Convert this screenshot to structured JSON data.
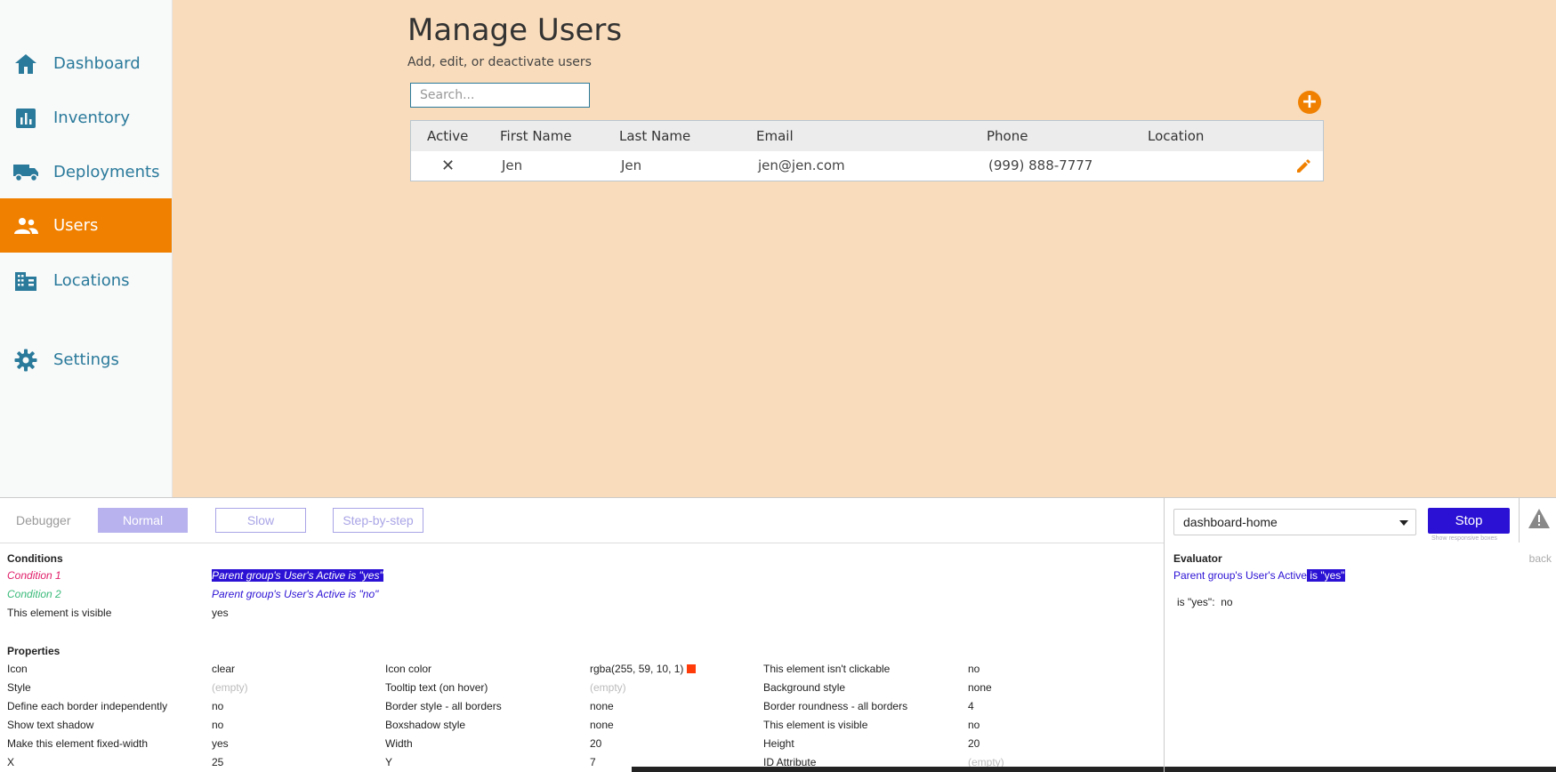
{
  "sidebar": {
    "items": [
      {
        "label": "Dashboard",
        "icon": "home-icon"
      },
      {
        "label": "Inventory",
        "icon": "bar-chart-icon"
      },
      {
        "label": "Deployments",
        "icon": "truck-icon"
      },
      {
        "label": "Users",
        "icon": "users-icon",
        "active": true
      },
      {
        "label": "Locations",
        "icon": "building-icon"
      },
      {
        "label": "Settings",
        "icon": "gear-icon"
      }
    ]
  },
  "main": {
    "title": "Manage Users",
    "subtitle": "Add, edit, or deactivate users",
    "search_placeholder": "Search...",
    "add_symbol": "+",
    "table": {
      "headers": [
        "Active",
        "First Name",
        "Last Name",
        "Email",
        "Phone",
        "Location"
      ],
      "rows": [
        {
          "active": "✕",
          "first_name": "Jen",
          "last_name": "Jen",
          "email": "jen@jen.com",
          "phone": "(999) 888-7777",
          "location": ""
        }
      ]
    }
  },
  "debugger": {
    "label": "Debugger",
    "modes": [
      "Normal",
      "Slow",
      "Step-by-step"
    ],
    "active_mode": "Normal",
    "page_select": "dashboard-home",
    "stop_label": "Stop",
    "responsive_label": "Show responsive boxes",
    "conditions": {
      "title": "Conditions",
      "items": [
        {
          "name": "Condition 1",
          "expr": "Parent group's User's Active is \"yes\""
        },
        {
          "name": "Condition 2",
          "expr": "Parent group's User's Active is \"no\""
        },
        {
          "name": "This element is visible",
          "expr": "yes"
        }
      ]
    },
    "properties": {
      "title": "Properties",
      "rows": [
        [
          [
            "Icon",
            "clear"
          ],
          [
            "Icon color",
            "rgba(255, 59, 10, 1)"
          ],
          [
            "This element isn't clickable",
            "no"
          ]
        ],
        [
          [
            "Style",
            "(empty)"
          ],
          [
            "Tooltip text (on hover)",
            "(empty)"
          ],
          [
            "Background style",
            "none"
          ]
        ],
        [
          [
            "Define each border independently",
            "no"
          ],
          [
            "Border style - all borders",
            "none"
          ],
          [
            "Border roundness - all borders",
            "4"
          ]
        ],
        [
          [
            "Show text shadow",
            "no"
          ],
          [
            "Boxshadow style",
            "none"
          ],
          [
            "This element is visible",
            "no"
          ]
        ],
        [
          [
            "Make this element fixed-width",
            "yes"
          ],
          [
            "Width",
            "20"
          ],
          [
            "Height",
            "20"
          ]
        ],
        [
          [
            "X",
            "25"
          ],
          [
            "Y",
            "7"
          ],
          [
            "ID Attribute",
            "(empty)"
          ]
        ]
      ]
    },
    "evaluator": {
      "title": "Evaluator",
      "back": "back",
      "expr_prefix": "Parent group's User's Active",
      "expr_hl": " is \"yes\"",
      "result_label": "is \"yes\":",
      "result_value": "no"
    }
  },
  "colors": {
    "accent": "#f08000",
    "nav_text": "#2a7a9b",
    "main_bg": "#f9dcbb",
    "debugger_primary": "#2b11d4",
    "icon_color": "#ff3b0a"
  }
}
